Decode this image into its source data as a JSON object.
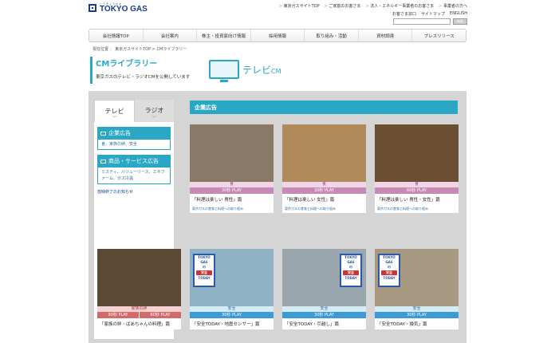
{
  "header": {
    "logo_sub": "とうきょうがす",
    "logo_name": "TOKYO GAS"
  },
  "topnav": [
    "東京ガスサイトTOP",
    "ご家庭のお客さま",
    "法人・エネルギー事業者のお客さま",
    "事業者の方へ"
  ],
  "search": {
    "button": "検索"
  },
  "topnav2": [
    "お客さま窓口",
    "サイトマップ",
    "ENGLISH"
  ],
  "gnav": [
    "会社情報TOP",
    "会社案内",
    "株主・投資家向け情報",
    "採用情報",
    "取り組み・活動",
    "資材調達",
    "プレスリリース"
  ],
  "breadcrumb": "現在位置 ： 東京ガスサイトTOP > CMライブラリー",
  "page": {
    "title": "CMライブラリー",
    "desc": "東京ガスのテレビ・ラジオCMを公開しています",
    "tv_label": "テレビ",
    "tv_label_small": "CM"
  },
  "sidebar": {
    "tab_tv": "テレビ",
    "tab_radio": "ラジオ",
    "cat1": "企業広告",
    "cat1_sub": "食、家族の絆、安全",
    "cat2": "商品・サービス広告",
    "cat2_sub": "ミスティ、バリューリース、エネファーム、ガス冷温",
    "end": "放映終了のお知らせ"
  },
  "main": {
    "title": "企業広告"
  },
  "cards": [
    {
      "cat": "食",
      "plays": [
        "30秒 PLAY"
      ],
      "title": "「料理は楽しい 男性」篇",
      "link": "東京ガスの食育と料理への取り組み"
    },
    {
      "cat": "食",
      "plays": [
        "30秒 PLAY"
      ],
      "title": "「料理は楽しい 女性」篇",
      "link": "東京ガスの食育と料理への取り組み"
    },
    {
      "cat": "食",
      "plays": [
        "60秒 PLAY"
      ],
      "title": "「料理は楽しい 男性・女性」篇",
      "link": "東京ガスの食育と料理への取り組み"
    },
    {
      "cat": "家族の絆",
      "plays": [
        "90秒 PLAY",
        "60秒 PLAY"
      ],
      "title": "「家族の絆・ばあちゃんの料理」篇"
    },
    {
      "cat": "安全",
      "plays": [
        "30秒 PLAY"
      ],
      "title": "「安全TODAY・地震センサー」篇"
    },
    {
      "cat": "安全",
      "plays": [
        "30秒 PLAY"
      ],
      "title": "「安全TODAY・引越し」篇"
    },
    {
      "cat": "安全",
      "plays": [
        "30秒 PLAY"
      ],
      "title": "「安全TODAY・換気」篇"
    }
  ],
  "poster": {
    "l1": "TOKYO",
    "l2": "GAS",
    "l3": "の",
    "l4": "安全",
    "l5": "TODAY"
  }
}
